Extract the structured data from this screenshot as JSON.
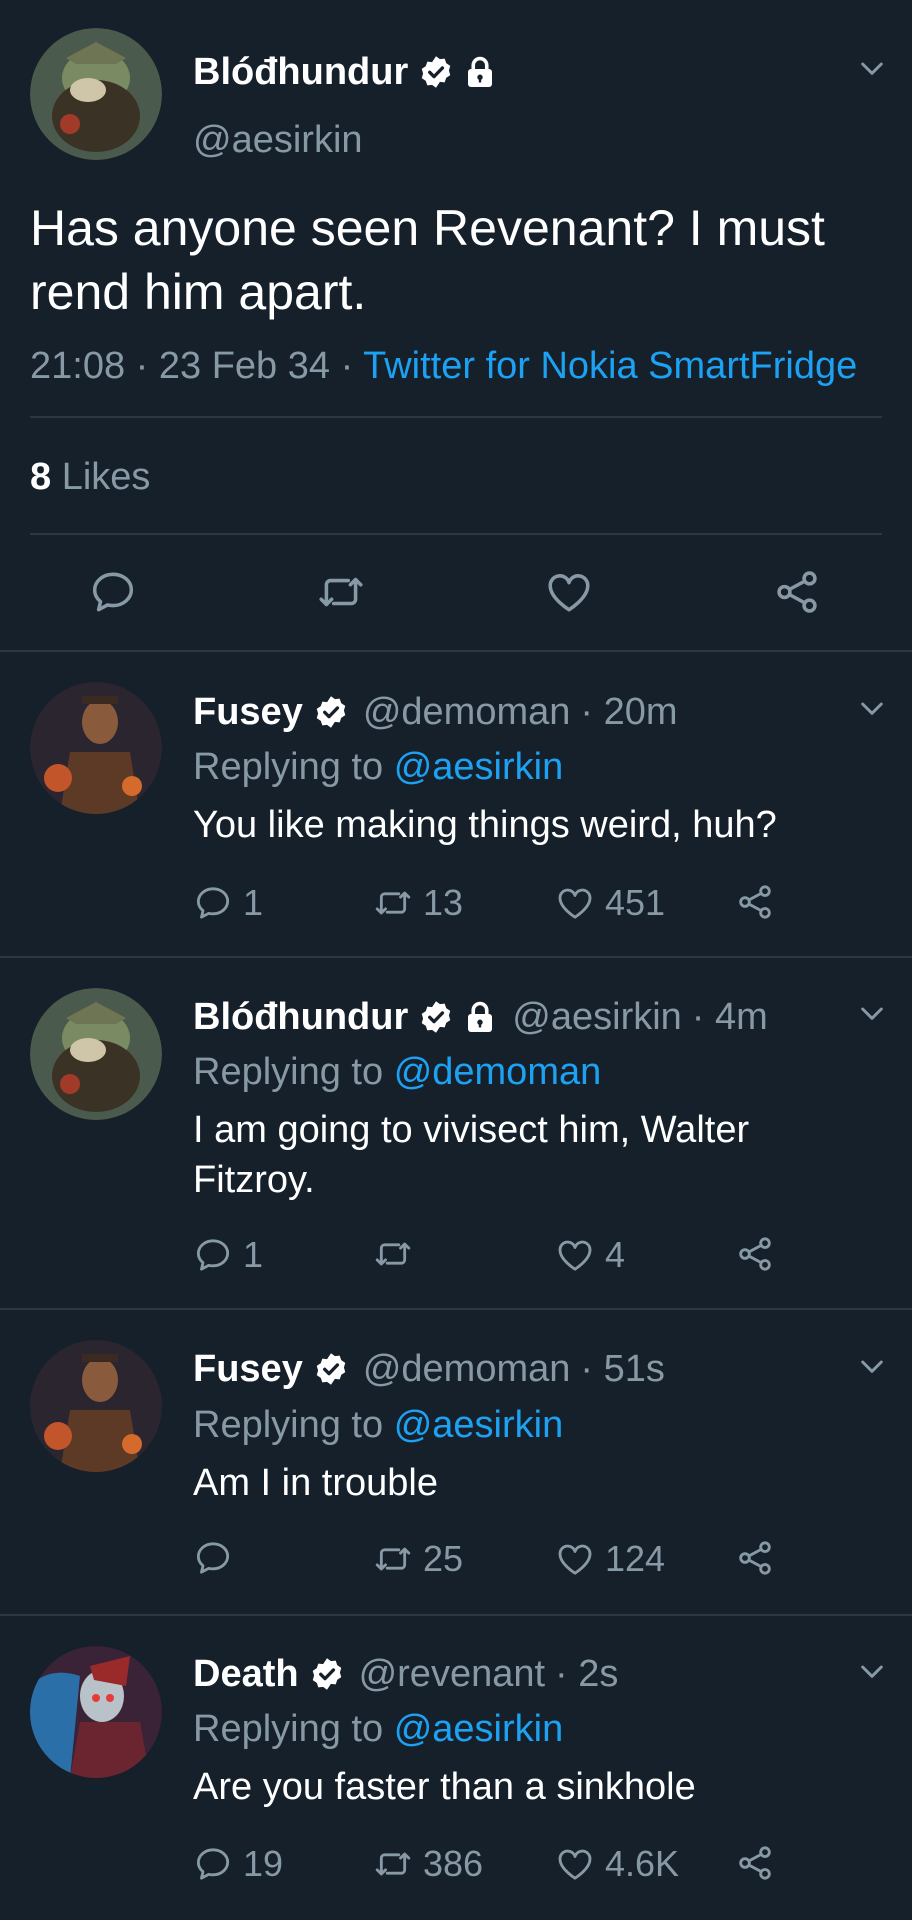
{
  "main_tweet": {
    "name": "Blóđhundur",
    "handle": "@aesirkin",
    "text": "Has anyone seen Revenant? I must rend him apart.",
    "time": "21:08",
    "separator": " · ",
    "date": "23 Feb 34",
    "source": "Twitter for Nokia SmartFridge",
    "likes_count": "8",
    "likes_label": "Likes"
  },
  "replies": [
    {
      "name": "Fusey",
      "handle": "@demoman",
      "time": "· 20m",
      "replying_label": "Replying to",
      "replying_to": "@aesirkin",
      "text": "You like making things weird, huh?",
      "reply_count": "1",
      "retweet_count": "13",
      "like_count": "451"
    },
    {
      "name": "Blóđhundur",
      "handle": "@aesirkin",
      "time": "· 4m",
      "replying_label": "Replying to",
      "replying_to": "@demoman",
      "text": "I am going to vivisect him, Walter Fitzroy.",
      "reply_count": "1",
      "retweet_count": "",
      "like_count": "4"
    },
    {
      "name": "Fusey",
      "handle": "@demoman",
      "time": "· 51s",
      "replying_label": "Replying to",
      "replying_to": "@aesirkin",
      "text": "Am I in trouble",
      "reply_count": "",
      "retweet_count": "25",
      "like_count": "124"
    },
    {
      "name": "Death",
      "handle": "@revenant",
      "time": "· 2s",
      "replying_label": "Replying to",
      "replying_to": "@aesirkin",
      "text": "Are you faster than a sinkhole",
      "reply_count": "19",
      "retweet_count": "386",
      "like_count": "4.6K"
    }
  ],
  "icons": {
    "reply": "reply-icon",
    "retweet": "retweet-icon",
    "like": "like-icon",
    "share": "share-icon",
    "verified": "verified-icon",
    "lock": "lock-icon",
    "chevron": "chevron-down-icon"
  },
  "colors": {
    "background": "#15202b",
    "muted": "#8899a6",
    "link": "#1da1f2",
    "divider": "#2a3744"
  }
}
